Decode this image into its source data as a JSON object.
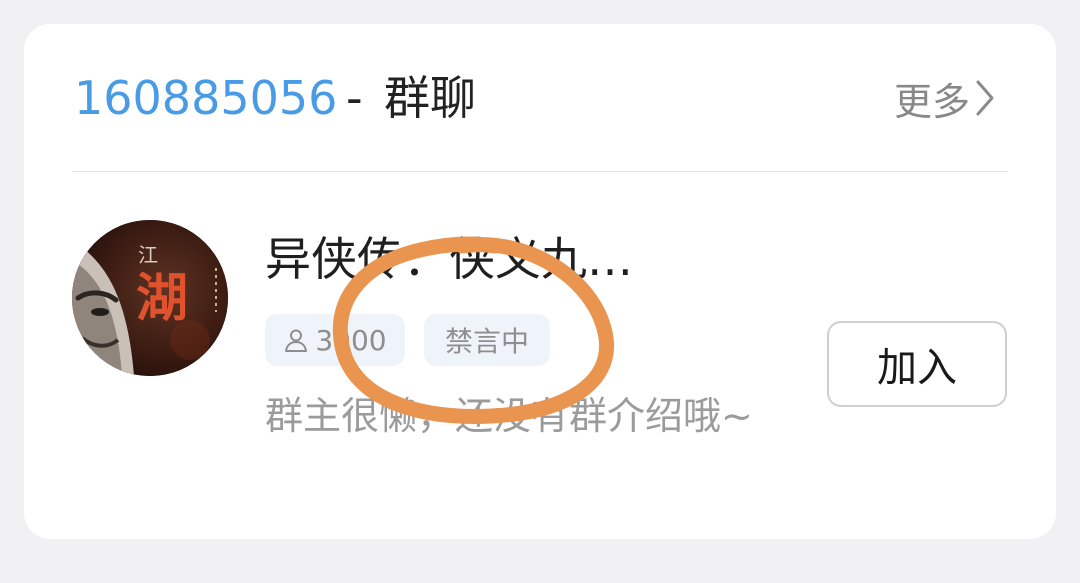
{
  "header": {
    "group_id": "160885056",
    "separator": "-",
    "title": "群聊",
    "more_label": "更多"
  },
  "group": {
    "name": "异侠传：侠义九…",
    "member_count": "3000",
    "status_badge": "禁言中",
    "description": "群主很懒，还没有群介绍哦~",
    "avatar_text": "江湖"
  },
  "actions": {
    "join_label": "加入"
  },
  "colors": {
    "id_blue": "#4a9be6",
    "annotation_orange": "#e9954f",
    "chip_bg": "#eff4fb"
  },
  "icons": {
    "more": "chevron-right-icon",
    "members": "person-icon"
  }
}
